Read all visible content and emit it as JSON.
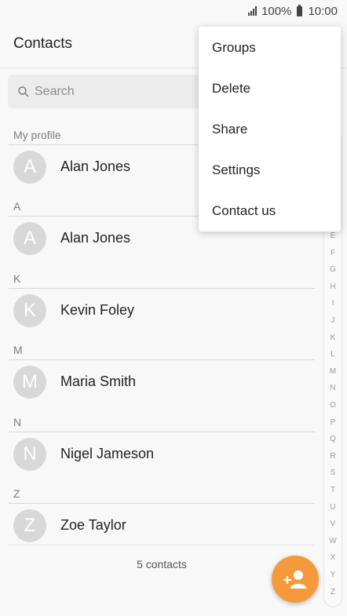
{
  "status_bar": {
    "battery": "100%",
    "time": "10:00"
  },
  "app_bar": {
    "title": "Contacts"
  },
  "search": {
    "placeholder": "Search"
  },
  "sections": [
    {
      "header": "My profile",
      "contacts": [
        {
          "initial": "A",
          "name": "Alan Jones"
        }
      ]
    },
    {
      "header": "A",
      "contacts": [
        {
          "initial": "A",
          "name": "Alan Jones"
        }
      ]
    },
    {
      "header": "K",
      "contacts": [
        {
          "initial": "K",
          "name": "Kevin Foley"
        }
      ]
    },
    {
      "header": "M",
      "contacts": [
        {
          "initial": "M",
          "name": "Maria Smith"
        }
      ]
    },
    {
      "header": "N",
      "contacts": [
        {
          "initial": "N",
          "name": "Nigel Jameson"
        }
      ]
    },
    {
      "header": "Z",
      "contacts": [
        {
          "initial": "Z",
          "name": "Zoe Taylor"
        }
      ]
    }
  ],
  "footer": {
    "count": "5 contacts"
  },
  "index_letters": [
    "E",
    "F",
    "G",
    "H",
    "I",
    "J",
    "K",
    "L",
    "M",
    "N",
    "O",
    "P",
    "Q",
    "R",
    "S",
    "T",
    "U",
    "V",
    "W",
    "X",
    "Y",
    "Z"
  ],
  "menu": {
    "items": [
      "Groups",
      "Delete",
      "Share",
      "Settings",
      "Contact us"
    ]
  },
  "fab": {
    "icon": "add-contact-icon",
    "color": "#f49a3c"
  },
  "colors": {
    "avatar": "#d8d8d8",
    "background": "#f8f8f8"
  }
}
